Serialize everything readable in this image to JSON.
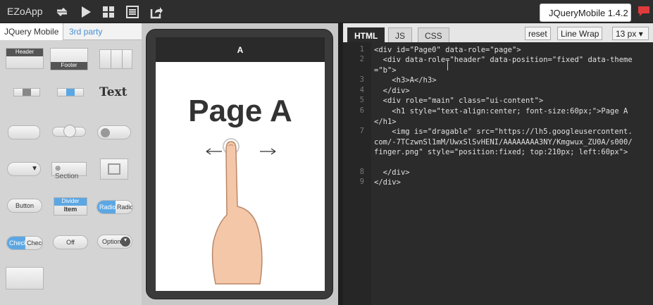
{
  "app": {
    "title": "EZoApp",
    "version_label": "JQueryMobile 1.4.2"
  },
  "toolbar": {
    "icons": [
      "refresh-icon",
      "play-icon",
      "grid-icon",
      "list-icon",
      "share-icon",
      "chat-icon"
    ]
  },
  "left_panel": {
    "tabs": [
      {
        "label": "JQuery Mobile"
      },
      {
        "label": "3rd party"
      }
    ],
    "palette": {
      "header": "Header",
      "footer": "Footer",
      "text": "Text",
      "section": "Section",
      "button": "Button",
      "divider": "Divider",
      "item": "Item",
      "radio1": "Radio",
      "radio2": "Radio",
      "check1": "Check",
      "check2": "Check",
      "off": "Off",
      "option": "Option"
    }
  },
  "preview": {
    "header": "A",
    "title": "Page A"
  },
  "editor": {
    "tabs": [
      {
        "label": "HTML"
      },
      {
        "label": "JS"
      },
      {
        "label": "CSS"
      }
    ],
    "reset_label": "reset",
    "wrap_label": "Line Wrap",
    "font_size_label": "13 px",
    "line_numbers": [
      "1",
      "2",
      "3",
      "4",
      "5",
      "6",
      "7",
      "8",
      "9"
    ],
    "lines": [
      "<div id=\"Page0\" data-role=\"page\">",
      "  <div data-role=\"header\" data-position=\"fixed\" data-theme=\"b\">",
      "    <h3>A</h3>",
      "  </div>",
      "  <div role=\"main\" class=\"ui-content\">",
      "    <h1 style=\"text-align:center; font-size:60px;\">Page A</h1>",
      "    <img is=\"dragable\" src=\"https://lh5.googleusercontent.com/-7TCzwnSl1mM/UwxSlSvHENI/AAAAAAAA3NY/Kmgwux_ZU0A/s000/finger.png\" style=\"position:fixed; top:210px; left:60px\">",
      "  </div>",
      "</div>"
    ]
  }
}
